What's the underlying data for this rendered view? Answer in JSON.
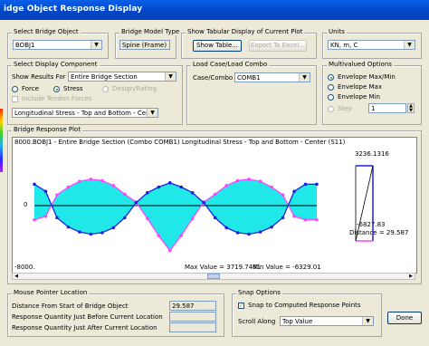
{
  "window": {
    "title": "idge Object Response Display"
  },
  "bridge_object": {
    "label": "Select Bridge Object",
    "value": "BOBJ1"
  },
  "model_type": {
    "label": "Bridge Model Type",
    "value": "Spine (Frame)"
  },
  "tabular": {
    "label": "Show Tabular Display of Current Plot",
    "show_table": "Show Table...",
    "export": "Export To Excel..."
  },
  "units": {
    "label": "Units",
    "value": "KN, m, C"
  },
  "display_component": {
    "label": "Select Display Component",
    "show_results_label": "Show Results For",
    "show_results_value": "Entire Bridge Section",
    "force": "Force",
    "stress": "Stress",
    "design": "Design/Rating",
    "include_tendon": "Include Tendon Forces",
    "component_value": "Longitudinal Stress - Top and Bottom - Center (S11)"
  },
  "load_case": {
    "label": "Load Case/Load Combo",
    "case_label": "Case/Combo",
    "case_value": "COMB1"
  },
  "multivalued": {
    "label": "Multivalued Options",
    "opt_maxmin": "Envelope Max/Min",
    "opt_max": "Envelope Max",
    "opt_min": "Envelope Min",
    "opt_step": "Step",
    "step_value": "1"
  },
  "plot": {
    "label": "Bridge Response Plot",
    "ymax_label": "8000.",
    "ymin_label": "-8000.",
    "zero_label": "0",
    "header": "BOBJ1 - Entire Bridge Section   (Combo COMB1)   Longitudinal Stress - Top and Bottom - Center (S11)",
    "max_text": "Max Value = 3719.7461",
    "min_text": "Min Value = -6329.01",
    "side_top": "3236.1316",
    "side_bottom": "-6827.83",
    "distance": "Distance = 29.587"
  },
  "chart_data": {
    "type": "line",
    "ylim": [
      -8000,
      8000
    ],
    "x": [
      0,
      4,
      8,
      12,
      16,
      20,
      24,
      28,
      32,
      36,
      40,
      44,
      48,
      52,
      56,
      60,
      64,
      68,
      72,
      76,
      80,
      84,
      88,
      92,
      96,
      100
    ],
    "series": [
      {
        "values": [
          -2000,
          -1500,
          1500,
          2600,
          3400,
          3700,
          3500,
          2800,
          1600,
          500,
          -1800,
          -4200,
          -6300,
          -4200,
          -1800,
          500,
          1600,
          2800,
          3500,
          3700,
          3400,
          2600,
          1500,
          -1500,
          -2000,
          -2000
        ]
      },
      {
        "values": [
          3000,
          2000,
          -1700,
          -3000,
          -3700,
          -4000,
          -3800,
          -3100,
          -1700,
          400,
          1800,
          2600,
          3200,
          2600,
          1800,
          400,
          -1700,
          -3100,
          -3800,
          -4000,
          -3700,
          -3000,
          -1700,
          2000,
          3000,
          3000
        ]
      }
    ]
  },
  "mouse_pointer": {
    "label": "Mouse Pointer Location",
    "distance_label": "Distance From Start of Bridge Object",
    "distance_value": "29.587",
    "before_label": "Response Quantity Just Before Current Location",
    "after_label": "Response Quantity Just After Current Location"
  },
  "snap": {
    "label": "Snap Options",
    "snap_label": "Snap to Computed Response Points",
    "scroll_label": "Scroll Along",
    "scroll_value": "Top Value"
  },
  "done": "Done",
  "colors": {
    "fill": "#20e8e8",
    "top": "#ff44ff",
    "bottom": "#2020e0"
  }
}
